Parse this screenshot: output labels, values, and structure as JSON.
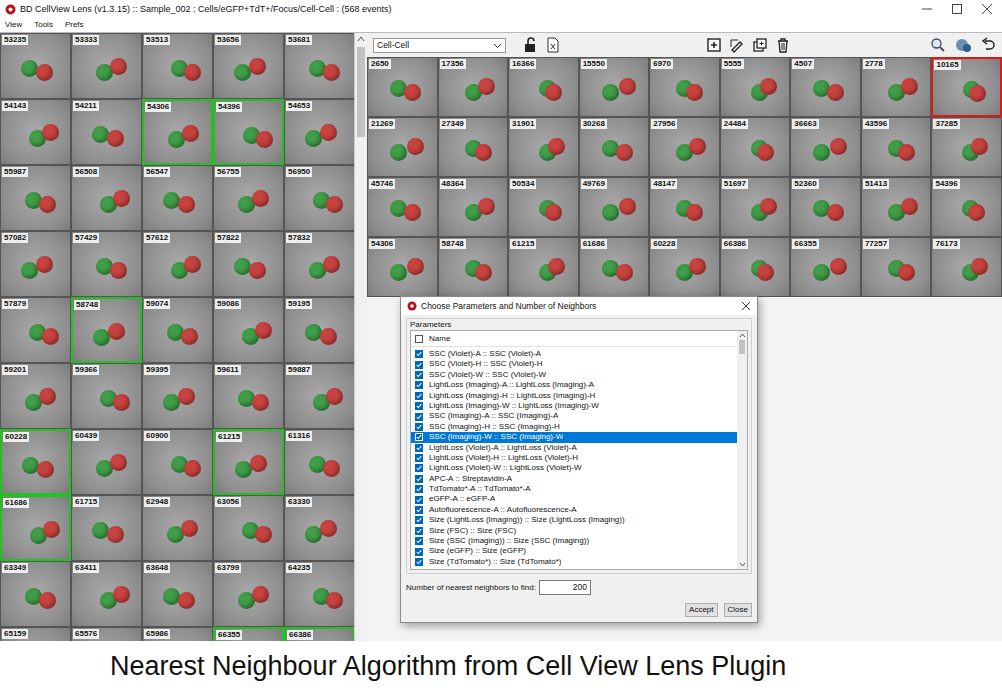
{
  "window": {
    "title": "BD CellView Lens (v1.3.15) :: Sample_002 : Cells/eGFP+TdT+/Focus/Cell-Cell : (568 events)"
  },
  "menu": [
    "View",
    "Tools",
    "Prefs"
  ],
  "left_grid": {
    "tiles": [
      {
        "id": "53235",
        "selected": false
      },
      {
        "id": "53333",
        "selected": false
      },
      {
        "id": "53513",
        "selected": false
      },
      {
        "id": "53656",
        "selected": false
      },
      {
        "id": "53681",
        "selected": false
      },
      {
        "id": "54143",
        "selected": false
      },
      {
        "id": "54211",
        "selected": false
      },
      {
        "id": "54306",
        "selected": true
      },
      {
        "id": "54396",
        "selected": true
      },
      {
        "id": "54653",
        "selected": false
      },
      {
        "id": "55987",
        "selected": false
      },
      {
        "id": "56508",
        "selected": false
      },
      {
        "id": "56547",
        "selected": false
      },
      {
        "id": "56755",
        "selected": false
      },
      {
        "id": "56950",
        "selected": false
      },
      {
        "id": "57082",
        "selected": false
      },
      {
        "id": "57429",
        "selected": false
      },
      {
        "id": "57612",
        "selected": false
      },
      {
        "id": "57822",
        "selected": false
      },
      {
        "id": "57832",
        "selected": false
      },
      {
        "id": "57879",
        "selected": false
      },
      {
        "id": "58748",
        "selected": true
      },
      {
        "id": "59074",
        "selected": false
      },
      {
        "id": "59086",
        "selected": false
      },
      {
        "id": "59195",
        "selected": false
      },
      {
        "id": "59201",
        "selected": false
      },
      {
        "id": "59366",
        "selected": false
      },
      {
        "id": "59395",
        "selected": false
      },
      {
        "id": "59611",
        "selected": false
      },
      {
        "id": "59887",
        "selected": false
      },
      {
        "id": "60228",
        "selected": true
      },
      {
        "id": "60439",
        "selected": false
      },
      {
        "id": "60900",
        "selected": false
      },
      {
        "id": "61215",
        "selected": true
      },
      {
        "id": "61316",
        "selected": false
      },
      {
        "id": "61686",
        "selected": true
      },
      {
        "id": "61715",
        "selected": false
      },
      {
        "id": "62948",
        "selected": false
      },
      {
        "id": "63056",
        "selected": false
      },
      {
        "id": "63330",
        "selected": false
      },
      {
        "id": "63349",
        "selected": false
      },
      {
        "id": "63411",
        "selected": false
      },
      {
        "id": "63648",
        "selected": false
      },
      {
        "id": "63799",
        "selected": false
      },
      {
        "id": "64235",
        "selected": false
      },
      {
        "id": "65159",
        "selected": false
      },
      {
        "id": "65576",
        "selected": false
      },
      {
        "id": "65986",
        "selected": false
      },
      {
        "id": "66355",
        "selected": true
      },
      {
        "id": "66386",
        "selected": true
      }
    ]
  },
  "toolbar": {
    "gate": "Cell-Cell"
  },
  "right_grid": {
    "tiles": [
      {
        "id": "2650",
        "selected": false
      },
      {
        "id": "17356",
        "selected": false
      },
      {
        "id": "16366",
        "selected": false
      },
      {
        "id": "15550",
        "selected": false
      },
      {
        "id": "6970",
        "selected": false
      },
      {
        "id": "5555",
        "selected": false
      },
      {
        "id": "4507",
        "selected": false
      },
      {
        "id": "2778",
        "selected": false
      },
      {
        "id": "10165",
        "selected": true
      },
      {
        "id": "21269",
        "selected": false
      },
      {
        "id": "27349",
        "selected": false
      },
      {
        "id": "31901",
        "selected": false
      },
      {
        "id": "30268",
        "selected": false
      },
      {
        "id": "27956",
        "selected": false
      },
      {
        "id": "24484",
        "selected": false
      },
      {
        "id": "36663",
        "selected": false
      },
      {
        "id": "43596",
        "selected": false
      },
      {
        "id": "37285",
        "selected": false
      },
      {
        "id": "45746",
        "selected": false
      },
      {
        "id": "48364",
        "selected": false
      },
      {
        "id": "50534",
        "selected": false
      },
      {
        "id": "49769",
        "selected": false
      },
      {
        "id": "48147",
        "selected": false
      },
      {
        "id": "51697",
        "selected": false
      },
      {
        "id": "52360",
        "selected": false
      },
      {
        "id": "51413",
        "selected": false
      },
      {
        "id": "54396",
        "selected": false
      },
      {
        "id": "54306",
        "selected": false
      },
      {
        "id": "58748",
        "selected": false
      },
      {
        "id": "61215",
        "selected": false
      },
      {
        "id": "61686",
        "selected": false
      },
      {
        "id": "60228",
        "selected": false
      },
      {
        "id": "66386",
        "selected": false
      },
      {
        "id": "66355",
        "selected": false
      },
      {
        "id": "77257",
        "selected": false
      },
      {
        "id": "76173",
        "selected": false
      }
    ]
  },
  "dialog": {
    "title": "Choose Parameters and Number of Neighbors",
    "group": "Parameters",
    "header": {
      "label": "Name",
      "checked": false
    },
    "parameters": [
      {
        "name": "SSC (Violet)-A :: SSC (Violet)-A",
        "checked": true,
        "selected": false
      },
      {
        "name": "SSC (Violet)-H :: SSC (Violet)-H",
        "checked": true,
        "selected": false
      },
      {
        "name": "SSC (Violet)-W :: SSC (Violet)-W",
        "checked": true,
        "selected": false
      },
      {
        "name": "LightLoss (Imaging)-A :: LightLoss (Imaging)-A",
        "checked": true,
        "selected": false
      },
      {
        "name": "LightLoss (Imaging)-H :: LightLoss (Imaging)-H",
        "checked": true,
        "selected": false
      },
      {
        "name": "LightLoss (Imaging)-W :: LightLoss (Imaging)-W",
        "checked": true,
        "selected": false
      },
      {
        "name": "SSC (Imaging)-A :: SSC (Imaging)-A",
        "checked": true,
        "selected": false
      },
      {
        "name": "SSC (Imaging)-H :: SSC (Imaging)-H",
        "checked": true,
        "selected": false
      },
      {
        "name": "SSC (Imaging)-W :: SSC (Imaging)-W",
        "checked": true,
        "selected": true
      },
      {
        "name": "LightLoss (Violet)-A :: LightLoss (Violet)-A",
        "checked": true,
        "selected": false
      },
      {
        "name": "LightLoss (Violet)-H :: LightLoss (Violet)-H",
        "checked": true,
        "selected": false
      },
      {
        "name": "LightLoss (Violet)-W :: LightLoss (Violet)-W",
        "checked": true,
        "selected": false
      },
      {
        "name": "APC-A :: Streptavidin-A",
        "checked": true,
        "selected": false
      },
      {
        "name": "TdTomato*-A :: TdTomato*-A",
        "checked": true,
        "selected": false
      },
      {
        "name": "eGFP-A :: eGFP-A",
        "checked": true,
        "selected": false
      },
      {
        "name": "Autofluorescence-A :: Autofluorescence-A",
        "checked": true,
        "selected": false
      },
      {
        "name": "Size (LightLoss (Imaging)) :: Size (LightLoss (Imaging))",
        "checked": true,
        "selected": false
      },
      {
        "name": "Size (FSC) :: Size (FSC)",
        "checked": true,
        "selected": false
      },
      {
        "name": "Size (SSC (Imaging)) :: Size (SSC (Imaging))",
        "checked": true,
        "selected": false
      },
      {
        "name": "Size (eGFP) :: Size (eGFP)",
        "checked": true,
        "selected": false
      },
      {
        "name": "Size (TdTomato*) :: Size (TdTomato*)",
        "checked": true,
        "selected": false
      }
    ],
    "neighbors": {
      "label": "Number of nearest neighbors to find:",
      "value": "200"
    },
    "buttons": [
      "Accept",
      "Close"
    ]
  },
  "caption": "Nearest Neighbour Algorithm from Cell View Lens Plugin"
}
